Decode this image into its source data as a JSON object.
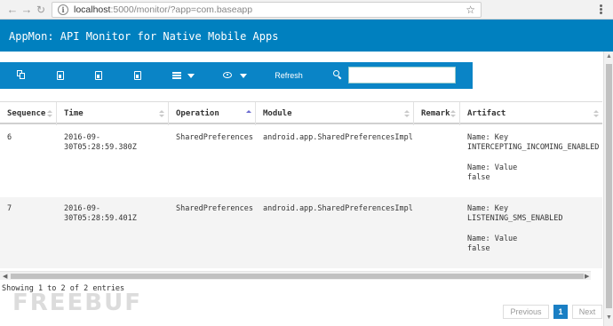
{
  "browser": {
    "url_host": "localhost",
    "url_rest": ":5000/monitor/?app=com.baseapp"
  },
  "app": {
    "title": "AppMon: API Monitor for Native Mobile Apps"
  },
  "toolbar": {
    "refresh_label": "Refresh",
    "search_value": ""
  },
  "table": {
    "columns": [
      "Sequence",
      "Time",
      "Operation",
      "Module",
      "Remark",
      "Artifact"
    ],
    "rows": [
      {
        "sequence": "6",
        "time_line1": "2016-09-",
        "time_line2": "30T05:28:59.380Z",
        "operation": "SharedPreferences",
        "module": "android.app.SharedPreferencesImpl",
        "remark": "",
        "artifact_line1": "Name: Key",
        "artifact_line2": "INTERCEPTING_INCOMING_ENABLED",
        "artifact_line3": "Name: Value",
        "artifact_line4": "false"
      },
      {
        "sequence": "7",
        "time_line1": "2016-09-",
        "time_line2": "30T05:28:59.401Z",
        "operation": "SharedPreferences",
        "module": "android.app.SharedPreferencesImpl",
        "remark": "",
        "artifact_line1": "Name: Key",
        "artifact_line2": "LISTENING_SMS_ENABLED",
        "artifact_line3": "Name: Value",
        "artifact_line4": "false"
      }
    ]
  },
  "info": "Showing 1 to 2 of 2 entries",
  "pagination": {
    "previous": "Previous",
    "current": "1",
    "next": "Next"
  },
  "watermark": "FREEBUF"
}
